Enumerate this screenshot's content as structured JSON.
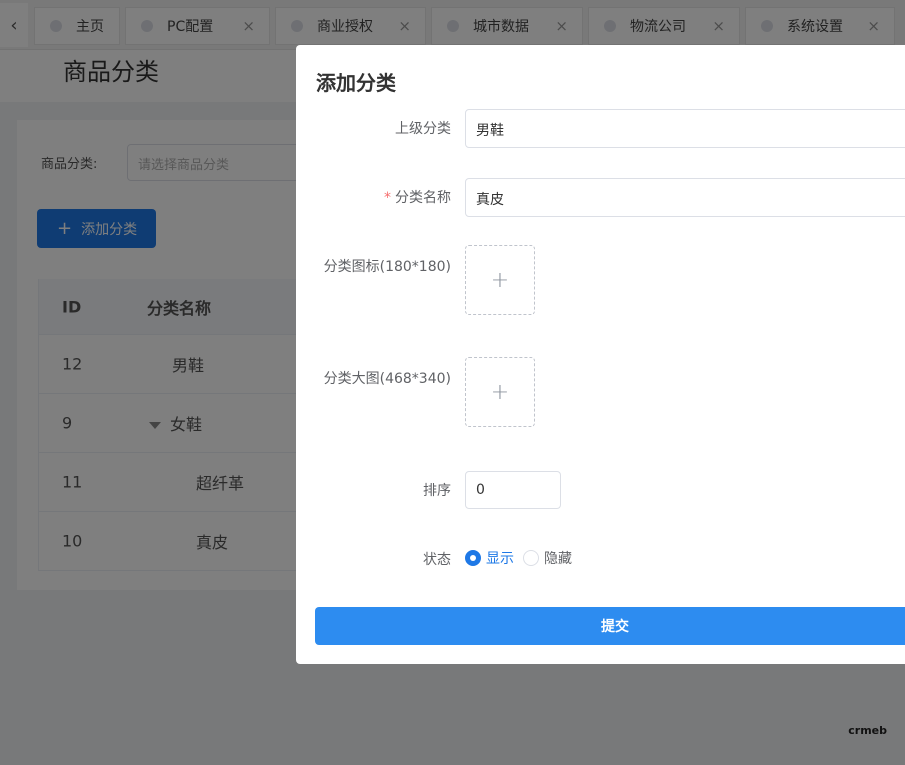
{
  "tabs": [
    {
      "label": "主页",
      "closable": false
    },
    {
      "label": "PC配置",
      "closable": true
    },
    {
      "label": "商业授权",
      "closable": true
    },
    {
      "label": "城市数据",
      "closable": true
    },
    {
      "label": "物流公司",
      "closable": true
    },
    {
      "label": "系统设置",
      "closable": true
    }
  ],
  "icons": {
    "tab_prev": "‹",
    "tab_close": "×",
    "plus": "+"
  },
  "page": {
    "title": "商品分类"
  },
  "filter": {
    "label": "商品分类:",
    "placeholder": "请选择商品分类"
  },
  "toolbar": {
    "add_label": "添加分类"
  },
  "table": {
    "headers": {
      "id": "ID",
      "name": "分类名称"
    },
    "rows": [
      {
        "id": "12",
        "name": "男鞋",
        "level": 0,
        "expandable": false
      },
      {
        "id": "9",
        "name": "女鞋",
        "level": 0,
        "expandable": true
      },
      {
        "id": "11",
        "name": "超纤革",
        "level": 1,
        "expandable": false
      },
      {
        "id": "10",
        "name": "真皮",
        "level": 1,
        "expandable": false
      }
    ]
  },
  "dialog": {
    "title": "添加分类",
    "parent_label": "上级分类",
    "parent_value": "男鞋",
    "name_label": "分类名称",
    "name_value": "真皮",
    "icon_label": "分类图标(180*180)",
    "banner_label": "分类大图(468*340)",
    "sort_label": "排序",
    "sort_value": "0",
    "status_label": "状态",
    "status_options": [
      "显示",
      "隐藏"
    ],
    "status_selected": "显示",
    "submit_label": "提交"
  },
  "colors": {
    "primary": "#1e78e6",
    "submit": "#2d8cf0",
    "required": "#f56c6c"
  },
  "watermark": "crmeb"
}
